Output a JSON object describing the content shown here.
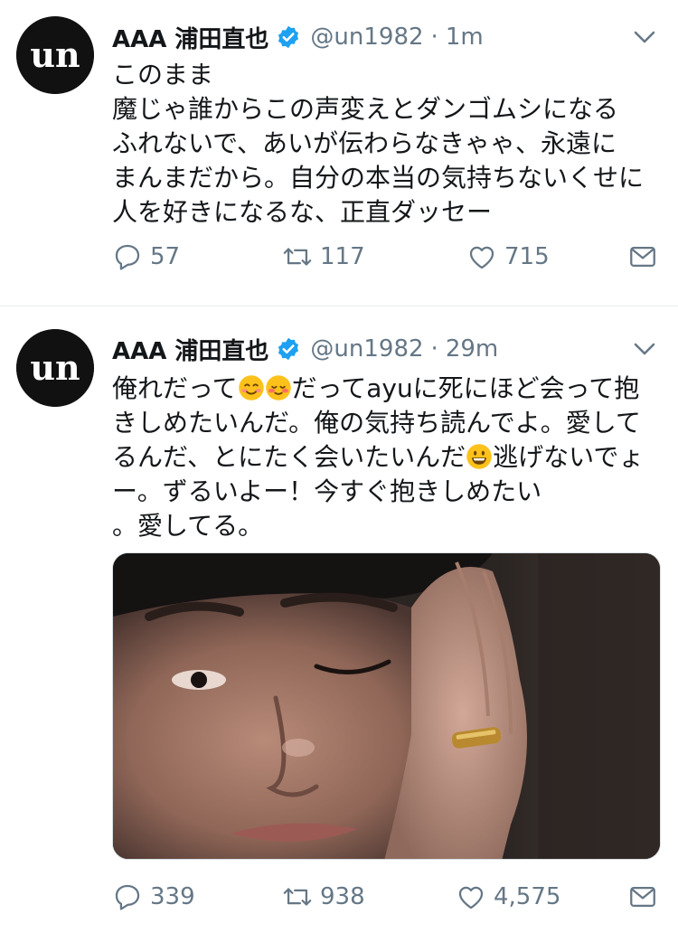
{
  "tweets": [
    {
      "author_name": "AAA 浦田直也",
      "handle": "@un1982",
      "separator": "·",
      "time": "1m",
      "text": "このまま\n魔じゃ誰からこの声変えとダンゴムシになる\nふれないで、あいが伝わらなきゃゃ、永遠に\nまんまだから。自分の本当の気持ちないくせに\n人を好きになるな、正直ダッセー",
      "replies": "57",
      "retweets": "117",
      "likes": "715"
    },
    {
      "author_name": "AAA 浦田直也",
      "handle": "@un1982",
      "separator": "·",
      "time": "29m",
      "text_a": "俺れだって",
      "text_b": "だってayuに死にほど会って抱きしめたいんだ。俺の気持ち読んでよ。愛してるんだ、とにたく会いたいんだ",
      "text_c": "逃げないでょー。ずるいよー！今すぐ抱きしめたい\n。愛してる。",
      "replies": "339",
      "retweets": "938",
      "likes": "4,575"
    }
  ],
  "avatar_logo": "un",
  "icons": {
    "reply": "reply-icon",
    "retweet": "retweet-icon",
    "like": "heart-icon",
    "dm": "mail-icon",
    "more": "chevron-down-icon",
    "verified": "verified-badge-icon"
  },
  "colors": {
    "text": "#14171a",
    "secondary": "#657786",
    "verified": "#1da1f2",
    "divider": "#e6ecf0"
  }
}
